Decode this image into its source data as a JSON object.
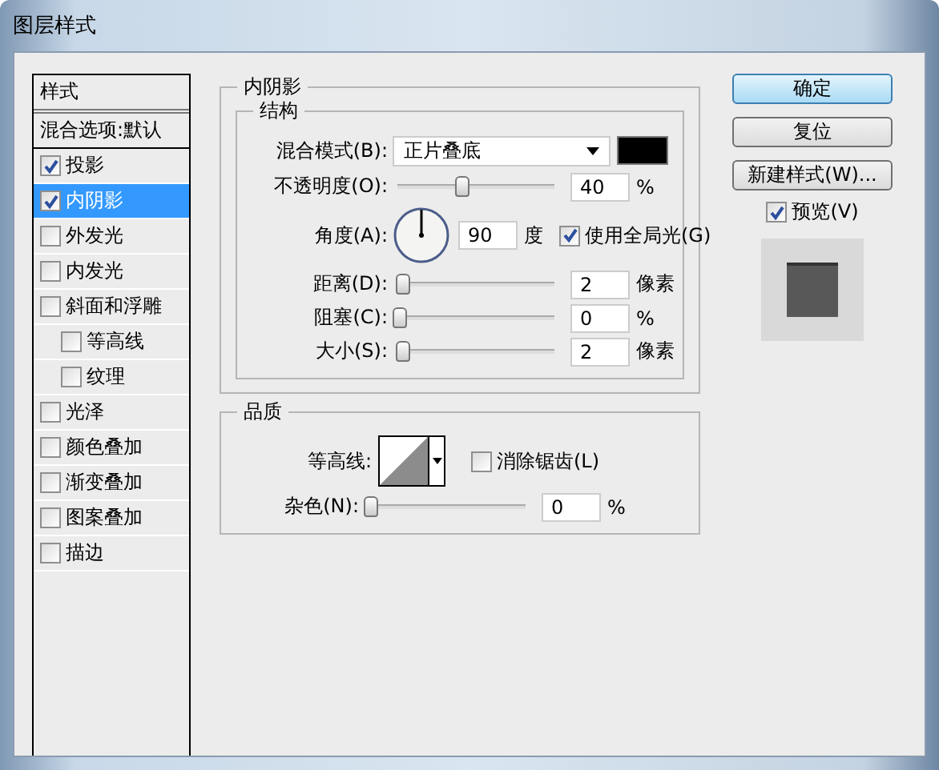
{
  "window": {
    "title": "图层样式"
  },
  "styles_header": "样式",
  "blend_options": "混合选项:默认",
  "styles": [
    {
      "label": "投影",
      "checked": true,
      "selected": false
    },
    {
      "label": "内阴影",
      "checked": true,
      "selected": true
    },
    {
      "label": "外发光",
      "checked": false,
      "selected": false
    },
    {
      "label": "内发光",
      "checked": false,
      "selected": false
    },
    {
      "label": "斜面和浮雕",
      "checked": false,
      "selected": false,
      "children": [
        {
          "label": "等高线",
          "checked": false,
          "selected": false
        },
        {
          "label": "纹理",
          "checked": false,
          "selected": false
        }
      ]
    },
    {
      "label": "光泽",
      "checked": false,
      "selected": false
    },
    {
      "label": "颜色叠加",
      "checked": false,
      "selected": false
    },
    {
      "label": "渐变叠加",
      "checked": false,
      "selected": false
    },
    {
      "label": "图案叠加",
      "checked": false,
      "selected": false
    },
    {
      "label": "描边",
      "checked": false,
      "selected": false
    }
  ],
  "panel": {
    "title": "内阴影",
    "structure": {
      "title": "结构",
      "rows": [
        {
          "kind": "dropdown",
          "label": "混合模式(B):",
          "value": "正片叠底"
        },
        {
          "kind": "slider",
          "label": "不透明度(O):",
          "level": 0.4,
          "value": "40",
          "unit": "%"
        },
        {
          "kind": "angle",
          "label": "角度(A):",
          "value": "90",
          "unit": "度",
          "checkbox": {
            "label": "使用全局光(G)",
            "checked": true
          }
        },
        {
          "kind": "slider",
          "label": "距离(D):",
          "level": 0.02,
          "value": "2",
          "unit": "像素"
        },
        {
          "kind": "slider",
          "label": "阻塞(C):",
          "level": 0,
          "value": "0",
          "unit": "%"
        },
        {
          "kind": "slider",
          "label": "大小(S):",
          "level": 0.02,
          "value": "2",
          "unit": "像素"
        }
      ]
    },
    "quality": {
      "title": "品质",
      "contour_label": "等高线:",
      "antialias": {
        "label": "消除锯齿(L)",
        "checked": false
      },
      "noise": {
        "label": "杂色(N):",
        "level": 0,
        "value": "0",
        "unit": "%"
      }
    }
  },
  "buttons": [
    "确定",
    "复位",
    "新建样式(W)..."
  ],
  "preview": {
    "label": "预览(V)",
    "checked": true
  }
}
